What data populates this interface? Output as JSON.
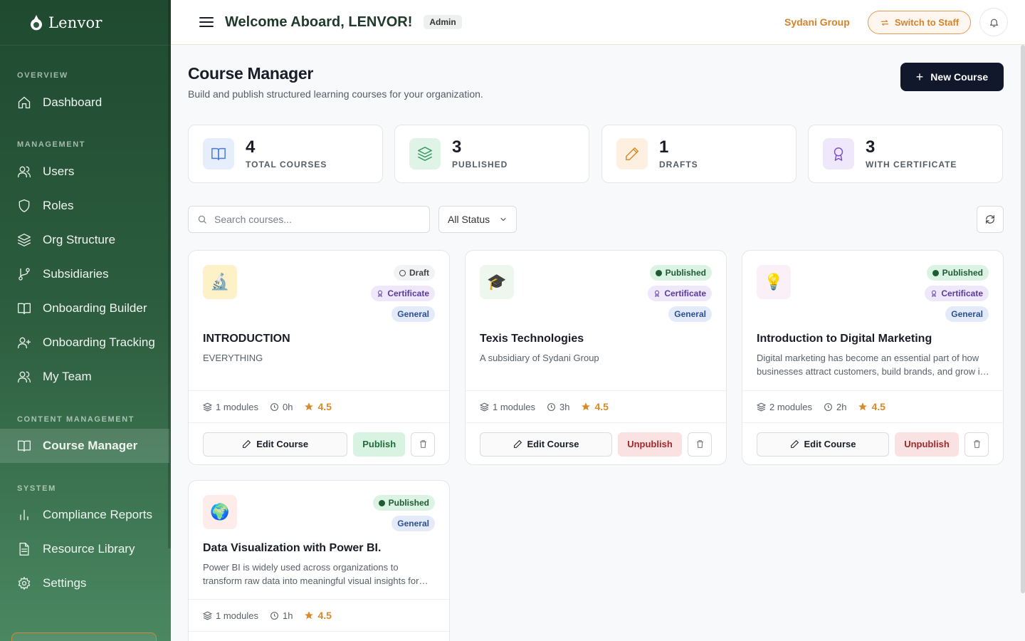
{
  "brand": {
    "name": "Lenvor"
  },
  "sidebar": {
    "sections": [
      {
        "label": "OVERVIEW",
        "items": [
          {
            "label": "Dashboard",
            "icon": "home-icon"
          }
        ]
      },
      {
        "label": "MANAGEMENT",
        "items": [
          {
            "label": "Users",
            "icon": "users-icon"
          },
          {
            "label": "Roles",
            "icon": "shield-icon"
          },
          {
            "label": "Org Structure",
            "icon": "layers-icon"
          },
          {
            "label": "Subsidiaries",
            "icon": "branch-icon"
          },
          {
            "label": "Onboarding Builder",
            "icon": "book-icon"
          },
          {
            "label": "Onboarding Tracking",
            "icon": "user-plus-icon"
          },
          {
            "label": "My Team",
            "icon": "team-icon"
          }
        ]
      },
      {
        "label": "CONTENT MANAGEMENT",
        "items": [
          {
            "label": "Course Manager",
            "icon": "book-open-icon",
            "active": true
          }
        ]
      },
      {
        "label": "SYSTEM",
        "items": [
          {
            "label": "Compliance Reports",
            "icon": "bar-chart-icon"
          },
          {
            "label": "Resource Library",
            "icon": "file-icon"
          },
          {
            "label": "Settings",
            "icon": "gear-icon"
          }
        ]
      }
    ]
  },
  "header": {
    "welcome": "Welcome Aboard, LENVOR!",
    "role": "Admin",
    "org": "Sydani Group",
    "switch_label": "Switch to Staff"
  },
  "page": {
    "title": "Course Manager",
    "subtitle": "Build and publish structured learning courses for your organization.",
    "new_course_label": "New Course"
  },
  "stats": [
    {
      "value": "4",
      "label": "TOTAL COURSES",
      "icon": "book-icon",
      "color": "#4a7bd6",
      "bg": "#e6edfb"
    },
    {
      "value": "3",
      "label": "PUBLISHED",
      "icon": "layers-icon",
      "color": "#3a9a63",
      "bg": "#e0f3e7"
    },
    {
      "value": "1",
      "label": "DRAFTS",
      "icon": "pencil-icon",
      "color": "#d98a2a",
      "bg": "#fdf0e0"
    },
    {
      "value": "3",
      "label": "WITH CERTIFICATE",
      "icon": "award-icon",
      "color": "#7b52c9",
      "bg": "#efe8fb"
    }
  ],
  "filters": {
    "search_placeholder": "Search courses...",
    "status_selected": "All Status"
  },
  "courses": [
    {
      "emoji": "🔬",
      "thumb_bg": "#fdf1c8",
      "status": "Draft",
      "certificate": "Certificate",
      "category": "General",
      "title": "INTRODUCTION",
      "description": "EVERYTHING",
      "modules": "1 modules",
      "duration": "0h",
      "rating": "4.5",
      "edit_label": "Edit Course",
      "action_label": "Publish"
    },
    {
      "emoji": "🎓",
      "thumb_bg": "#eef7ee",
      "status": "Published",
      "certificate": "Certificate",
      "category": "General",
      "title": "Texis Technologies",
      "description": "A subsidiary of Sydani Group",
      "modules": "1 modules",
      "duration": "3h",
      "rating": "4.5",
      "edit_label": "Edit Course",
      "action_label": "Unpublish"
    },
    {
      "emoji": "💡",
      "thumb_bg": "#fcf0f8",
      "status": "Published",
      "certificate": "Certificate",
      "category": "General",
      "title": "Introduction to Digital Marketing",
      "description": "Digital marketing has become an essential part of how businesses attract customers, build brands, and grow in the modern economy.",
      "modules": "2 modules",
      "duration": "2h",
      "rating": "4.5",
      "edit_label": "Edit Course",
      "action_label": "Unpublish"
    },
    {
      "emoji": "🌍",
      "thumb_bg": "#fdecea",
      "status": "Published",
      "category": "General",
      "title": "Data Visualization with Power BI.",
      "description": "Power BI is widely used across organizations to transform raw data into meaningful visual insights for decision making.",
      "modules": "1 modules",
      "duration": "1h",
      "rating": "4.5"
    }
  ],
  "colors": {
    "accent": "#d4832c",
    "dark_button": "#11182c",
    "sidebar": "#2d5e3f"
  }
}
